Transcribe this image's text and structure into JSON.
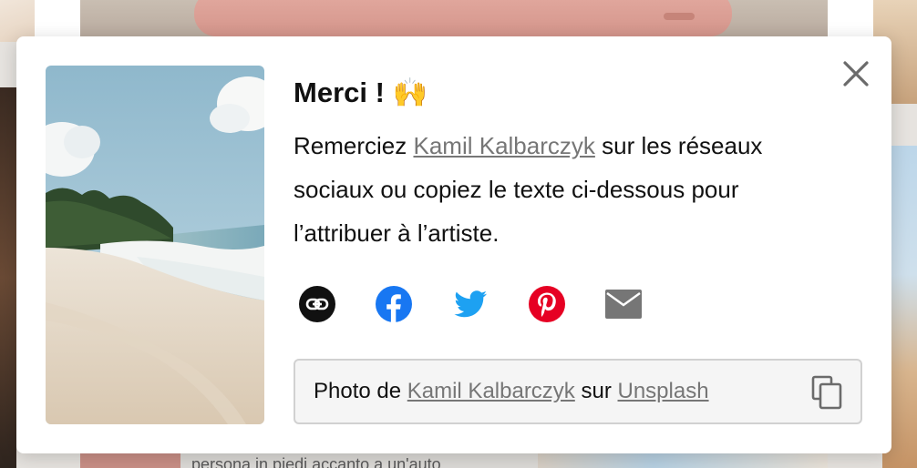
{
  "modal": {
    "title": "Merci !",
    "title_emoji": "🙌",
    "description": {
      "before": "Remerciez ",
      "artist": "Kamil Kalbarczyk",
      "after": " sur les réseaux sociaux ou copiez le texte ci-dessous pour l’attribuer à l’artiste."
    },
    "share_icons": [
      "link-icon",
      "facebook-icon",
      "twitter-icon",
      "pinterest-icon",
      "email-icon"
    ],
    "attribution": {
      "prefix": "Photo de ",
      "artist": "Kamil Kalbarczyk",
      "middle": " sur ",
      "source": "Unsplash"
    },
    "close_icon": "close-icon",
    "copy_icon": "copy-icon"
  },
  "background": {
    "tooltip_text": "persona in piedi accanto a un'auto"
  },
  "colors": {
    "facebook": "#1877f2",
    "twitter": "#1da1f2",
    "pinterest": "#e60023",
    "email": "#767676",
    "link_circle": "#111111",
    "link_text": "#767676"
  }
}
